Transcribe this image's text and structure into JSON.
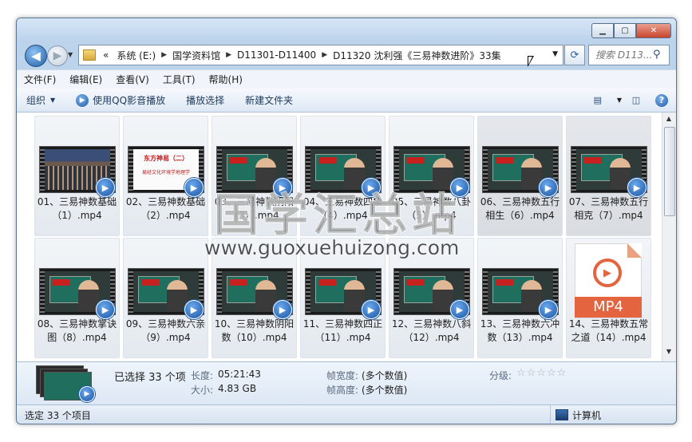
{
  "window": {
    "controls": [
      "▁",
      "▢",
      "✕"
    ]
  },
  "nav": {
    "back_glyph": "◀",
    "forward_glyph": "▶",
    "overflow": "«",
    "breadcrumbs": [
      "系统 (E:)",
      "国学资料馆",
      "D11301-D11400",
      "D11320 沈利强《三易神数进阶》33集"
    ],
    "search_placeholder": "搜索 D113..."
  },
  "menubar": {
    "items": [
      "文件(F)",
      "编辑(E)",
      "查看(V)",
      "工具(T)",
      "帮助(H)"
    ]
  },
  "toolbar": {
    "organize": "组织",
    "play_qq": "使用QQ影音播放",
    "play_selection": "播放选择",
    "new_folder": "新建文件夹"
  },
  "files": [
    {
      "name": "01、三易神数基础（1）.mp4",
      "thumb": "crowd"
    },
    {
      "name": "02、三易神数基础（2）.mp4",
      "thumb": "slide",
      "slide_title": "东方神易（二）",
      "slide_sub": "易经文化环境学地理学"
    },
    {
      "name": "03、三易神数阴阳（3）.mp4",
      "thumb": "board"
    },
    {
      "name": "04、三易神数四象（4）.mp4",
      "thumb": "board"
    },
    {
      "name": "05、三易神数八卦（5）.mp4",
      "thumb": "board"
    },
    {
      "name": "06、三易神数五行相生（6）.mp4",
      "thumb": "board"
    },
    {
      "name": "07、三易神数五行相克（7）.mp4",
      "thumb": "board"
    },
    {
      "name": "08、三易神数掌诀图（8）.mp4",
      "thumb": "board"
    },
    {
      "name": "09、三易神数六亲（9）.mp4",
      "thumb": "board"
    },
    {
      "name": "10、三易神数阴阳数（10）.mp4",
      "thumb": "board"
    },
    {
      "name": "11、三易神数四正（11）.mp4",
      "thumb": "board"
    },
    {
      "name": "12、三易神数八斜（12）.mp4",
      "thumb": "board"
    },
    {
      "name": "13、三易神数六冲数（13）.mp4",
      "thumb": "board"
    },
    {
      "name": "14、三易神数五常之道（14）.mp4",
      "thumb": "mp4",
      "badge": "MP4"
    }
  ],
  "details": {
    "selected": "已选择 33 个项",
    "length_key": "长度:",
    "length_val": "05:21:43",
    "size_key": "大小:",
    "size_val": "4.83 GB",
    "fwidth_key": "帧宽度:",
    "fwidth_val": "(多个数值)",
    "fheight_key": "帧高度:",
    "fheight_val": "(多个数值)",
    "rating_key": "分级:",
    "rating_stars": "☆☆☆☆☆"
  },
  "status": {
    "left": "选定 33 个项目",
    "right": "计算机"
  },
  "watermark": {
    "cn": "国学汇总站",
    "url": "www.guoxuehuizong.com"
  }
}
